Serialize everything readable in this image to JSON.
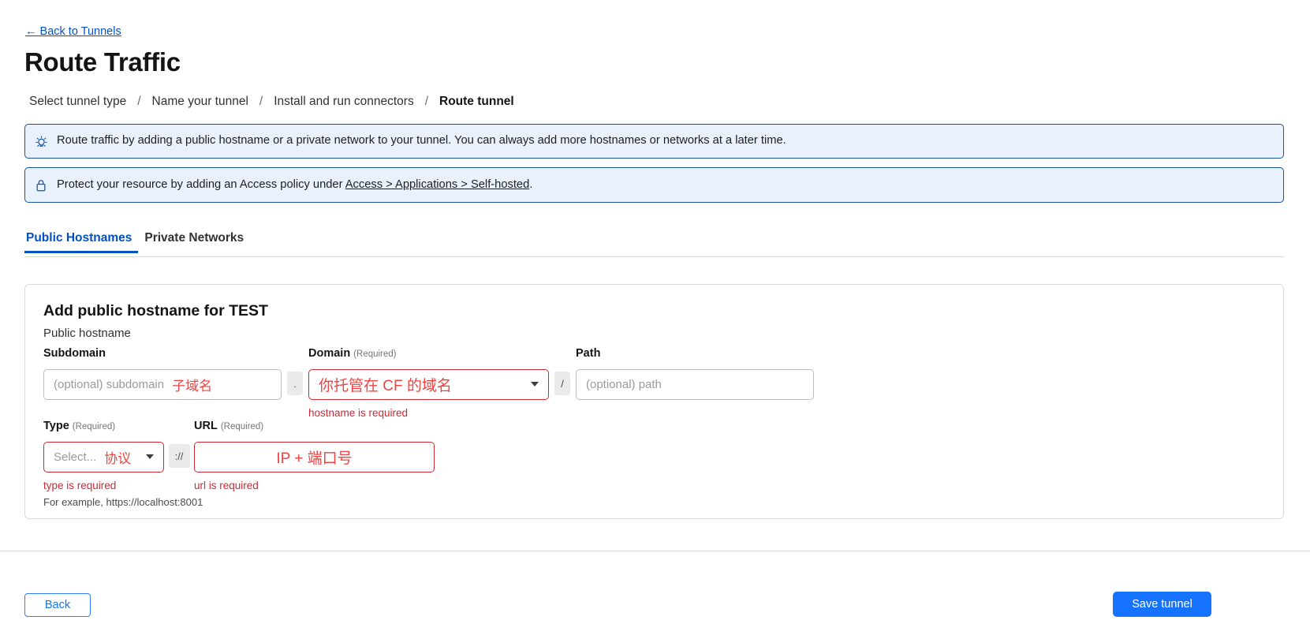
{
  "header": {
    "back_link": "← Back to Tunnels",
    "title": "Route Traffic",
    "breadcrumb": [
      {
        "label": "Select tunnel type",
        "current": false
      },
      {
        "label": "Name your tunnel",
        "current": false
      },
      {
        "label": "Install and run connectors",
        "current": false
      },
      {
        "label": "Route tunnel",
        "current": true
      }
    ],
    "breadcrumb_separator": "/"
  },
  "banners": [
    {
      "icon": "lightbulb-icon",
      "text": "Route traffic by adding a public hostname or a private network to your tunnel. You can always add more hostnames or networks at a later time."
    },
    {
      "icon": "lock-icon",
      "text_before": "Protect your resource by adding an Access policy under ",
      "link": "Access > Applications > Self-hosted",
      "text_after": "."
    }
  ],
  "tabs": [
    {
      "label": "Public Hostnames",
      "active": true
    },
    {
      "label": "Private Networks",
      "active": false
    }
  ],
  "card": {
    "title": "Add public hostname for TEST",
    "subtitle": "Public hostname",
    "subdomain": {
      "label": "Subdomain",
      "required_tag": "",
      "placeholder": "(optional) subdomain",
      "value": "",
      "annotation": "子域名"
    },
    "dot_separator": ".",
    "domain": {
      "label": "Domain",
      "required_tag": "(Required)",
      "value": "",
      "annotation": "你托管在 CF 的域名",
      "error": "hostname is required",
      "caret_icon": "chevron-down-icon"
    },
    "slash_separator": "/",
    "path": {
      "label": "Path",
      "required_tag": "",
      "placeholder": "(optional) path",
      "value": ""
    },
    "type": {
      "label": "Type",
      "required_tag": "(Required)",
      "placeholder": "Select...",
      "value": "",
      "annotation": "协议",
      "error": "type is required",
      "caret_icon": "chevron-down-icon"
    },
    "protocol_separator": "://",
    "url": {
      "label": "URL",
      "required_tag": "(Required)",
      "value": "",
      "annotation": "IP + 端口号",
      "error": "url is required",
      "help": "For example, https://localhost:8001"
    }
  },
  "footer": {
    "back_label": "Back",
    "save_label": "Save tunnel"
  },
  "colors": {
    "accent": "#0051c3",
    "save_button": "#1673ff",
    "banner_bg": "#e9f2fc",
    "banner_border": "#1c5298",
    "error": "#cc2936",
    "annotation": "#ef4343"
  }
}
